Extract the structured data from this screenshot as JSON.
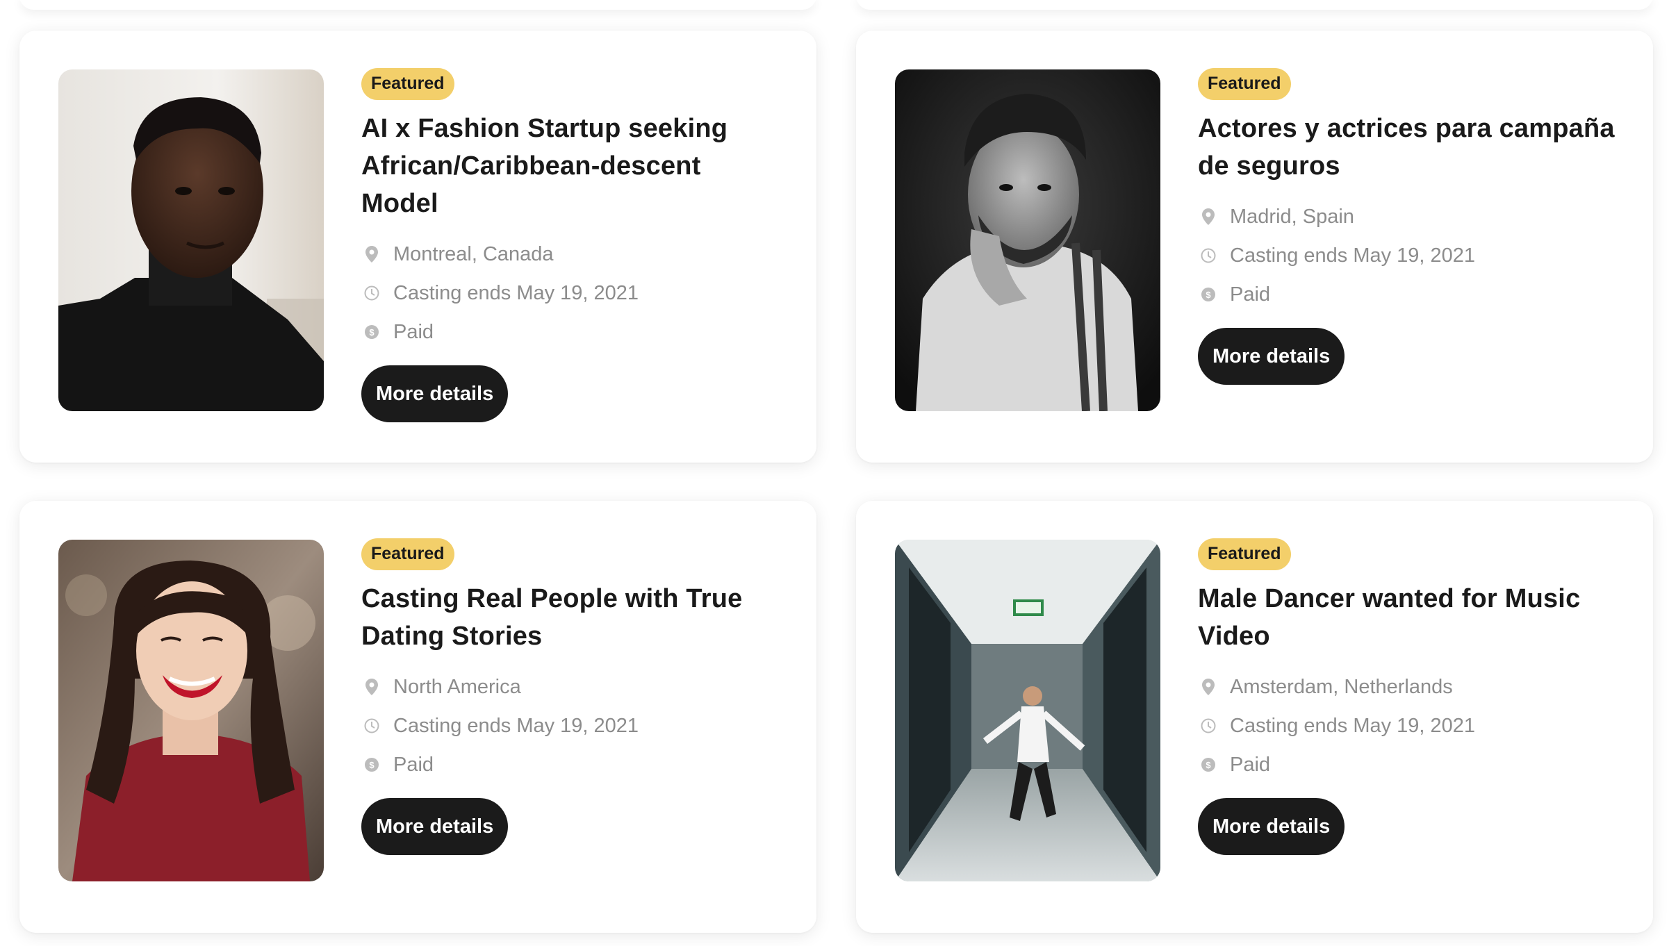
{
  "cards": [
    {
      "badge": "Featured",
      "title": "AI x Fashion Startup seeking African/Caribbean-descent Model",
      "location": "Montreal, Canada",
      "deadline": "Casting ends May 19, 2021",
      "pay": "Paid",
      "button": "More details",
      "photo": "portrait-man-black-turtleneck"
    },
    {
      "badge": "Featured",
      "title": "Actores y actrices para campaña de seguros",
      "location": "Madrid, Spain",
      "deadline": "Casting ends May 19, 2021",
      "pay": "Paid",
      "button": "More details",
      "photo": "portrait-man-bw-suspenders"
    },
    {
      "badge": "Featured",
      "title": "Casting Real People with True Dating Stories",
      "location": "North America",
      "deadline": "Casting ends May 19, 2021",
      "pay": "Paid",
      "button": "More details",
      "photo": "portrait-woman-red-top-smiling"
    },
    {
      "badge": "Featured",
      "title": "Male Dancer wanted for Music Video",
      "location": "Amsterdam, Netherlands",
      "deadline": "Casting ends May 19, 2021",
      "pay": "Paid",
      "button": "More details",
      "photo": "dancer-in-hallway"
    }
  ],
  "colors": {
    "badge_bg": "#f3cf6a",
    "button_bg": "#1b1b1b",
    "meta_text": "#8c8c8c",
    "title_text": "#1a1a1a"
  },
  "icons": {
    "location": "location-pin-icon",
    "deadline": "clock-icon",
    "pay": "dollar-coin-icon"
  }
}
